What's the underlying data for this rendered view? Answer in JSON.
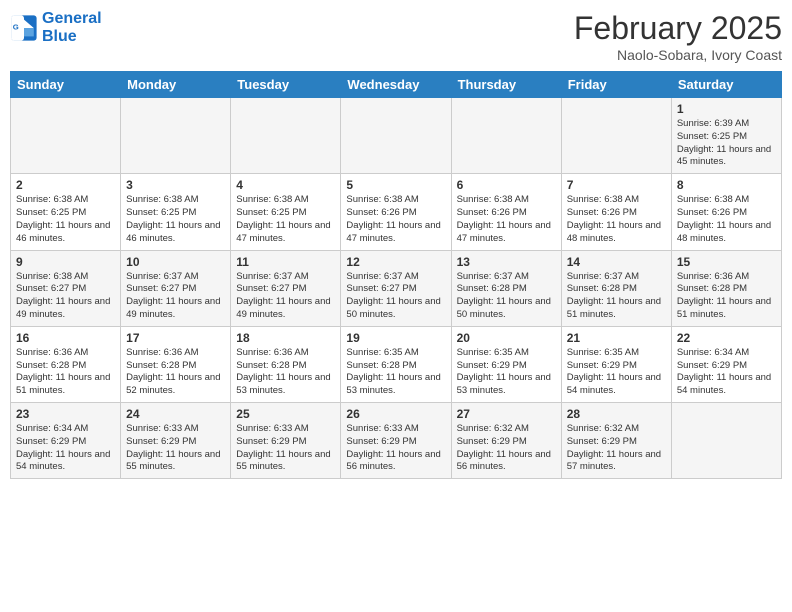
{
  "header": {
    "logo_line1": "General",
    "logo_line2": "Blue",
    "month_title": "February 2025",
    "location": "Naolo-Sobara, Ivory Coast"
  },
  "weekdays": [
    "Sunday",
    "Monday",
    "Tuesday",
    "Wednesday",
    "Thursday",
    "Friday",
    "Saturday"
  ],
  "weeks": [
    [
      {
        "day": "",
        "info": ""
      },
      {
        "day": "",
        "info": ""
      },
      {
        "day": "",
        "info": ""
      },
      {
        "day": "",
        "info": ""
      },
      {
        "day": "",
        "info": ""
      },
      {
        "day": "",
        "info": ""
      },
      {
        "day": "1",
        "info": "Sunrise: 6:39 AM\nSunset: 6:25 PM\nDaylight: 11 hours and 45 minutes."
      }
    ],
    [
      {
        "day": "2",
        "info": "Sunrise: 6:38 AM\nSunset: 6:25 PM\nDaylight: 11 hours and 46 minutes."
      },
      {
        "day": "3",
        "info": "Sunrise: 6:38 AM\nSunset: 6:25 PM\nDaylight: 11 hours and 46 minutes."
      },
      {
        "day": "4",
        "info": "Sunrise: 6:38 AM\nSunset: 6:25 PM\nDaylight: 11 hours and 47 minutes."
      },
      {
        "day": "5",
        "info": "Sunrise: 6:38 AM\nSunset: 6:26 PM\nDaylight: 11 hours and 47 minutes."
      },
      {
        "day": "6",
        "info": "Sunrise: 6:38 AM\nSunset: 6:26 PM\nDaylight: 11 hours and 47 minutes."
      },
      {
        "day": "7",
        "info": "Sunrise: 6:38 AM\nSunset: 6:26 PM\nDaylight: 11 hours and 48 minutes."
      },
      {
        "day": "8",
        "info": "Sunrise: 6:38 AM\nSunset: 6:26 PM\nDaylight: 11 hours and 48 minutes."
      }
    ],
    [
      {
        "day": "9",
        "info": "Sunrise: 6:38 AM\nSunset: 6:27 PM\nDaylight: 11 hours and 49 minutes."
      },
      {
        "day": "10",
        "info": "Sunrise: 6:37 AM\nSunset: 6:27 PM\nDaylight: 11 hours and 49 minutes."
      },
      {
        "day": "11",
        "info": "Sunrise: 6:37 AM\nSunset: 6:27 PM\nDaylight: 11 hours and 49 minutes."
      },
      {
        "day": "12",
        "info": "Sunrise: 6:37 AM\nSunset: 6:27 PM\nDaylight: 11 hours and 50 minutes."
      },
      {
        "day": "13",
        "info": "Sunrise: 6:37 AM\nSunset: 6:28 PM\nDaylight: 11 hours and 50 minutes."
      },
      {
        "day": "14",
        "info": "Sunrise: 6:37 AM\nSunset: 6:28 PM\nDaylight: 11 hours and 51 minutes."
      },
      {
        "day": "15",
        "info": "Sunrise: 6:36 AM\nSunset: 6:28 PM\nDaylight: 11 hours and 51 minutes."
      }
    ],
    [
      {
        "day": "16",
        "info": "Sunrise: 6:36 AM\nSunset: 6:28 PM\nDaylight: 11 hours and 51 minutes."
      },
      {
        "day": "17",
        "info": "Sunrise: 6:36 AM\nSunset: 6:28 PM\nDaylight: 11 hours and 52 minutes."
      },
      {
        "day": "18",
        "info": "Sunrise: 6:36 AM\nSunset: 6:28 PM\nDaylight: 11 hours and 53 minutes."
      },
      {
        "day": "19",
        "info": "Sunrise: 6:35 AM\nSunset: 6:28 PM\nDaylight: 11 hours and 53 minutes."
      },
      {
        "day": "20",
        "info": "Sunrise: 6:35 AM\nSunset: 6:29 PM\nDaylight: 11 hours and 53 minutes."
      },
      {
        "day": "21",
        "info": "Sunrise: 6:35 AM\nSunset: 6:29 PM\nDaylight: 11 hours and 54 minutes."
      },
      {
        "day": "22",
        "info": "Sunrise: 6:34 AM\nSunset: 6:29 PM\nDaylight: 11 hours and 54 minutes."
      }
    ],
    [
      {
        "day": "23",
        "info": "Sunrise: 6:34 AM\nSunset: 6:29 PM\nDaylight: 11 hours and 54 minutes."
      },
      {
        "day": "24",
        "info": "Sunrise: 6:33 AM\nSunset: 6:29 PM\nDaylight: 11 hours and 55 minutes."
      },
      {
        "day": "25",
        "info": "Sunrise: 6:33 AM\nSunset: 6:29 PM\nDaylight: 11 hours and 55 minutes."
      },
      {
        "day": "26",
        "info": "Sunrise: 6:33 AM\nSunset: 6:29 PM\nDaylight: 11 hours and 56 minutes."
      },
      {
        "day": "27",
        "info": "Sunrise: 6:32 AM\nSunset: 6:29 PM\nDaylight: 11 hours and 56 minutes."
      },
      {
        "day": "28",
        "info": "Sunrise: 6:32 AM\nSunset: 6:29 PM\nDaylight: 11 hours and 57 minutes."
      },
      {
        "day": "",
        "info": ""
      }
    ]
  ]
}
